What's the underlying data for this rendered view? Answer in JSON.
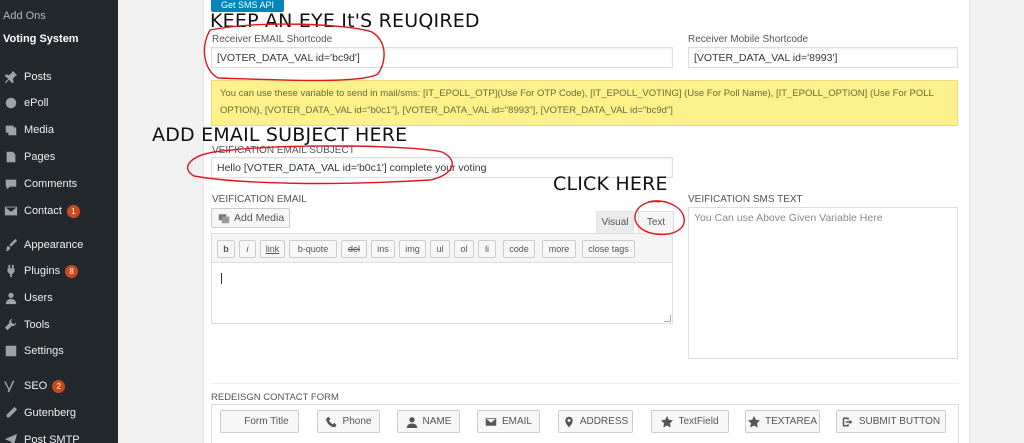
{
  "sidebar": {
    "sub_items": [
      {
        "label": "Add Ons",
        "current": false
      },
      {
        "label": "Voting System",
        "current": true
      }
    ],
    "items": [
      {
        "label": "Posts",
        "icon": "pin-icon",
        "badge": ""
      },
      {
        "label": "ePoll",
        "icon": "circle-icon",
        "badge": ""
      },
      {
        "label": "Media",
        "icon": "media-icon",
        "badge": ""
      },
      {
        "label": "Pages",
        "icon": "page-icon",
        "badge": ""
      },
      {
        "label": "Comments",
        "icon": "comment-icon",
        "badge": ""
      },
      {
        "label": "Contact",
        "icon": "mail-icon",
        "badge": "1"
      },
      {
        "label": "Appearance",
        "icon": "brush-icon",
        "badge": ""
      },
      {
        "label": "Plugins",
        "icon": "plug-icon",
        "badge": "8"
      },
      {
        "label": "Users",
        "icon": "user-icon",
        "badge": ""
      },
      {
        "label": "Tools",
        "icon": "wrench-icon",
        "badge": ""
      },
      {
        "label": "Settings",
        "icon": "settings-icon",
        "badge": ""
      },
      {
        "label": "SEO",
        "icon": "yoast-icon",
        "badge": "2"
      },
      {
        "label": "Gutenberg",
        "icon": "pen-icon",
        "badge": ""
      },
      {
        "label": "Post SMTP",
        "icon": "send-icon",
        "badge": ""
      }
    ]
  },
  "get_sms_api_label": "Get SMS API",
  "annotations": {
    "keep_eye": "KEEP AN EYE It'S REUQIRED",
    "add_subject": "ADD EMAIL SUBJECT HERE",
    "click_here": "CLICK HERE"
  },
  "receiver_email": {
    "label": "Receiver EMAIL Shortcode",
    "value": "[VOTER_DATA_VAL id='bc9d']"
  },
  "receiver_mobile": {
    "label": "Receiver Mobile Shortcode",
    "value": "[VOTER_DATA_VAL id='8993']"
  },
  "notice": {
    "line1": "You can use these variable to send in mail/sms: [IT_EPOLL_OTP](Use For OTP Code), [IT_EPOLL_VOTING] (Use For Poll Name), [IT_EPOLL_OPTION] (Use For POLL",
    "line2": "OPTION), [VOTER_DATA_VAL id=\"b0c1\"], [VOTER_DATA_VAL id=\"8993\"], [VOTER_DATA_VAL id=\"bc9d\"]"
  },
  "email_subject": {
    "label": "VEIFICATION EMAIL SUBJECT",
    "value": "Hello [VOTER_DATA_VAL id='b0c1'] complete your voting"
  },
  "email_body": {
    "label": "VEIFICATION EMAIL",
    "add_media_label": "Add Media",
    "tab_visual": "Visual",
    "tab_text": "Text",
    "quicktags": [
      "b",
      "i",
      "link",
      "b-quote",
      "del",
      "ins",
      "img",
      "ul",
      "ol",
      "li",
      "code",
      "more",
      "close tags"
    ]
  },
  "sms_text": {
    "label": "VEIFICATION SMS TEXT",
    "placeholder": "You Can use Above Given Variable Here"
  },
  "contact_form": {
    "label": "REDEISGN CONTACT FORM",
    "buttons": [
      {
        "label": "Form Title",
        "icon": "blank-icon"
      },
      {
        "label": "Phone",
        "icon": "phone-icon"
      },
      {
        "label": "NAME",
        "icon": "user-icon"
      },
      {
        "label": "EMAIL",
        "icon": "envelope-icon"
      },
      {
        "label": "ADDRESS",
        "icon": "location-icon"
      },
      {
        "label": "TextField",
        "icon": "star-icon"
      },
      {
        "label": "TEXTAREA",
        "icon": "star-icon"
      },
      {
        "label": "SUBMIT BUTTON",
        "icon": "submit-icon"
      }
    ]
  },
  "colors": {
    "sidebar_bg": "#23282d",
    "accent": "#0085ba",
    "badge": "#ca4a1f",
    "notice_bg": "#fcf18a",
    "annotation_red": "#e0171f"
  }
}
